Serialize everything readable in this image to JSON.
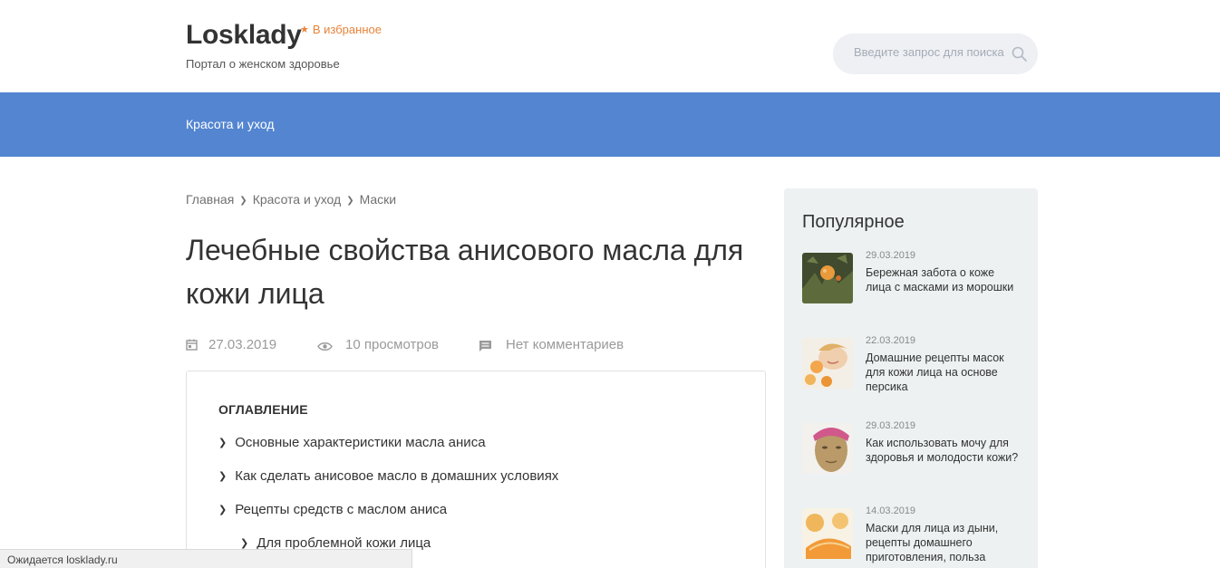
{
  "header": {
    "logo": "Losklady",
    "favorite_label": "В избранное",
    "tagline": "Портал о женском здоровье",
    "search": {
      "placeholder": "Введите запрос для поиска"
    }
  },
  "nav": {
    "items": [
      {
        "label": "Красота и уход"
      }
    ]
  },
  "breadcrumb": {
    "items": [
      "Главная",
      "Красота и уход",
      "Маски"
    ],
    "separator": "❯"
  },
  "article": {
    "title": "Лечебные свойства анисового масла для кожи лица",
    "date": "27.03.2019",
    "views": "10 просмотров",
    "comments": "Нет комментариев"
  },
  "toc": {
    "title": "ОГЛАВЛЕНИЕ",
    "chevron": "❯",
    "items": [
      "Основные характеристики масла аниса",
      "Как сделать анисовое масло в домашних условиях",
      "Рецепты средств с маслом аниса",
      "Для проблемной кожи лица"
    ]
  },
  "sidebar": {
    "title": "Популярное",
    "items": [
      {
        "date": "29.03.2019",
        "text": "Бережная забота о коже лица с масками из морошки"
      },
      {
        "date": "22.03.2019",
        "text": "Домашние рецепты масок для кожи лица на основе персика"
      },
      {
        "date": "29.03.2019",
        "text": "Как использовать мочу для здоровья и молодости кожи?"
      },
      {
        "date": "14.03.2019",
        "text": "Маски для лица из дыни, рецепты домашнего приготовления, польза"
      }
    ]
  },
  "status_bar": {
    "text": "Ожидается losklady.ru"
  },
  "colors": {
    "nav_bg": "#5385d1",
    "accent": "#e8833a",
    "sidebar_bg": "#edf1f1",
    "search_bg": "#eef0f4"
  }
}
